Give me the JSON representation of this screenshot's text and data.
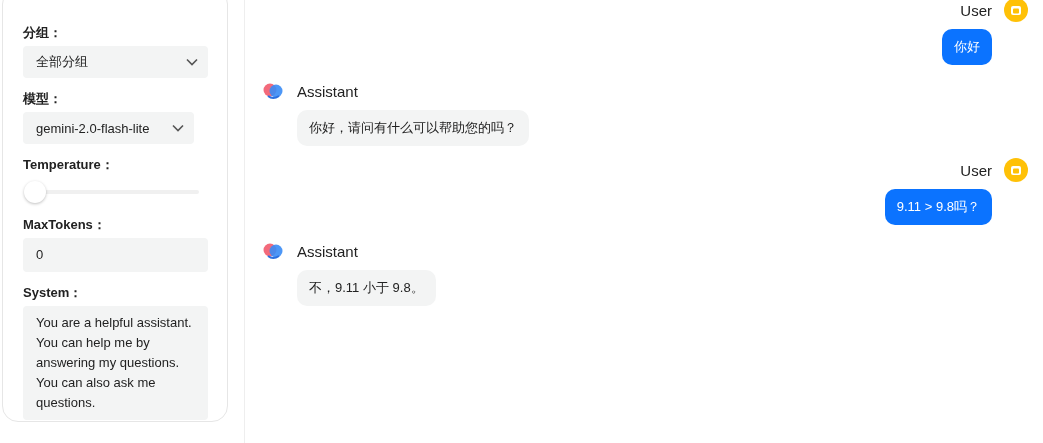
{
  "settings": {
    "group": {
      "label": "分组：",
      "value": "全部分组"
    },
    "model": {
      "label": "模型：",
      "value": "gemini-2.0-flash-lite"
    },
    "temperature": {
      "label": "Temperature：",
      "level": 0
    },
    "max_tokens": {
      "label": "MaxTokens：",
      "value": "0"
    },
    "system": {
      "label": "System：",
      "value": "You are a helpful assistant. You can help me by answering my questions. You can also ask me questions."
    }
  },
  "messages": [
    {
      "kind": "user",
      "name": "User",
      "text": "你好"
    },
    {
      "kind": "assistant",
      "name": "Assistant",
      "text": "你好，请问有什么可以帮助您的吗？"
    },
    {
      "kind": "user",
      "name": "User",
      "text": "9.11 > 9.8吗？"
    },
    {
      "kind": "assistant",
      "name": "Assistant",
      "text": "不，9.11 小于 9.8。"
    }
  ]
}
